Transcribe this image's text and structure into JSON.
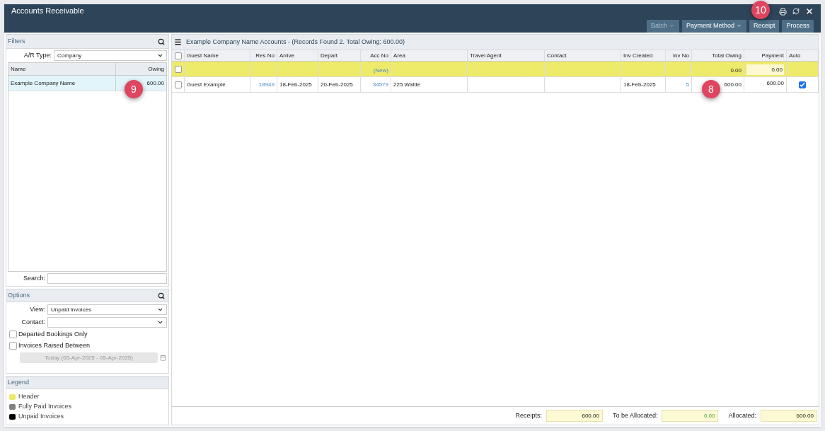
{
  "window": {
    "title": "Accounts Receivable"
  },
  "toolbar": {
    "buttons": [
      {
        "label": "Batch",
        "caret": true,
        "disabled": true
      },
      {
        "label": "Payment Method",
        "caret": true,
        "disabled": false
      },
      {
        "label": "Receipt",
        "caret": false,
        "disabled": false
      },
      {
        "label": "Process",
        "caret": false,
        "disabled": false
      }
    ]
  },
  "callouts": [
    {
      "label": "9"
    },
    {
      "label": "8"
    },
    {
      "label": "10"
    }
  ],
  "filters": {
    "title": "Filters",
    "ar_type_label": "A/R Type:",
    "ar_type_value": "Company",
    "columns": [
      "Name",
      "Owing"
    ],
    "rows": [
      {
        "name": "Example Company Name",
        "owing": "600.00",
        "selected": true
      }
    ],
    "search_label": "Search:"
  },
  "options": {
    "title": "Options",
    "view_label": "View:",
    "view_value": "Unpaid Invoices",
    "contact_label": "Contact:",
    "checks": [
      {
        "label": "Departed Bookings Only",
        "checked": false
      },
      {
        "label": "Invoices Raised Between",
        "checked": false
      }
    ],
    "date_range": "Today (05-Apr-2025 - 05-Apr-2025)"
  },
  "legend": {
    "title": "Legend",
    "items": [
      {
        "label": "Header",
        "color": "#eeea6a"
      },
      {
        "label": "Fully Paid Invoices",
        "color": "#808080"
      },
      {
        "label": "Unpaid Invoices",
        "color": "#000000"
      }
    ]
  },
  "table": {
    "title": "Example Company Name Accounts - (Records Found 2. Total Owing: 600.00)",
    "select_all_checked": false,
    "columns": [
      "Guest Name",
      "Res No",
      "Arrive",
      "Depart",
      "Acc No",
      "Area",
      "Travel Agent",
      "Contact",
      "Inv Created",
      "Inv No",
      "Total Owing",
      "Payment",
      "Auto"
    ],
    "rows": [
      {
        "kind": "header",
        "checked": false,
        "cells": [
          "",
          "",
          "",
          "",
          "(New)",
          "",
          "",
          "",
          "",
          "",
          "0.00",
          "0.00",
          ""
        ],
        "auto": false
      },
      {
        "kind": "invoice",
        "checked": false,
        "cells": [
          "Guest Example",
          "18949",
          "18-Feb-2025",
          "20-Feb-2025",
          "34579",
          "225 Wattle",
          "",
          "",
          "18-Feb-2025",
          "5",
          "600.00",
          "600.00",
          ""
        ],
        "auto": true
      }
    ]
  },
  "totals": [
    {
      "label": "Receipts:",
      "value": "600.00"
    },
    {
      "label": "To be Allocated:",
      "value": "0.00"
    },
    {
      "label": "Allocated:",
      "value": "600.00"
    }
  ]
}
